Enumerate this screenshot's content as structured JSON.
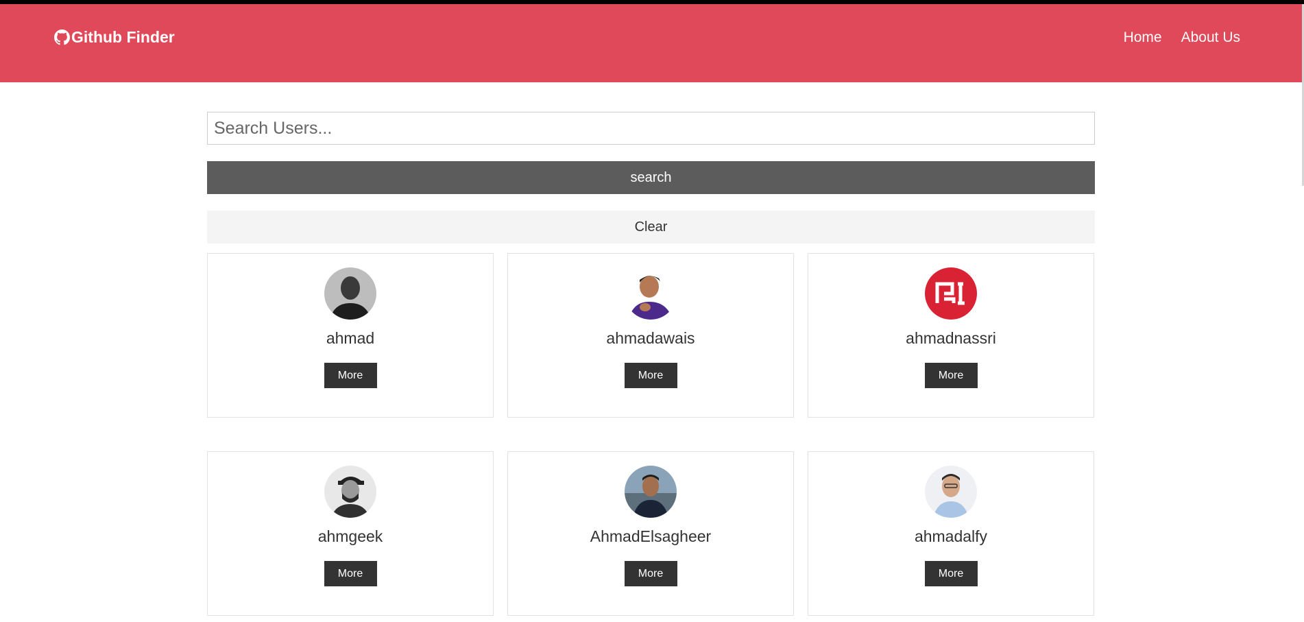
{
  "navbar": {
    "brand": "Github Finder",
    "brand_icon": "github-icon",
    "bg_color": "#e04959",
    "links": [
      {
        "label": "Home"
      },
      {
        "label": "About Us"
      }
    ]
  },
  "search": {
    "placeholder": "Search Users...",
    "value": "",
    "search_label": "search",
    "clear_label": "Clear"
  },
  "users": [
    {
      "login": "ahmad",
      "more_label": "More",
      "avatar_icon": "user-avatar-bw"
    },
    {
      "login": "ahmadawais",
      "more_label": "More",
      "avatar_icon": "user-avatar-color"
    },
    {
      "login": "ahmadnassri",
      "more_label": "More",
      "avatar_icon": "red-logo-avatar"
    },
    {
      "login": "ahmgeek",
      "more_label": "More",
      "avatar_icon": "user-avatar-bw"
    },
    {
      "login": "AhmadElsagheer",
      "more_label": "More",
      "avatar_icon": "user-avatar-color"
    },
    {
      "login": "ahmadalfy",
      "more_label": "More",
      "avatar_icon": "user-avatar-color"
    }
  ]
}
